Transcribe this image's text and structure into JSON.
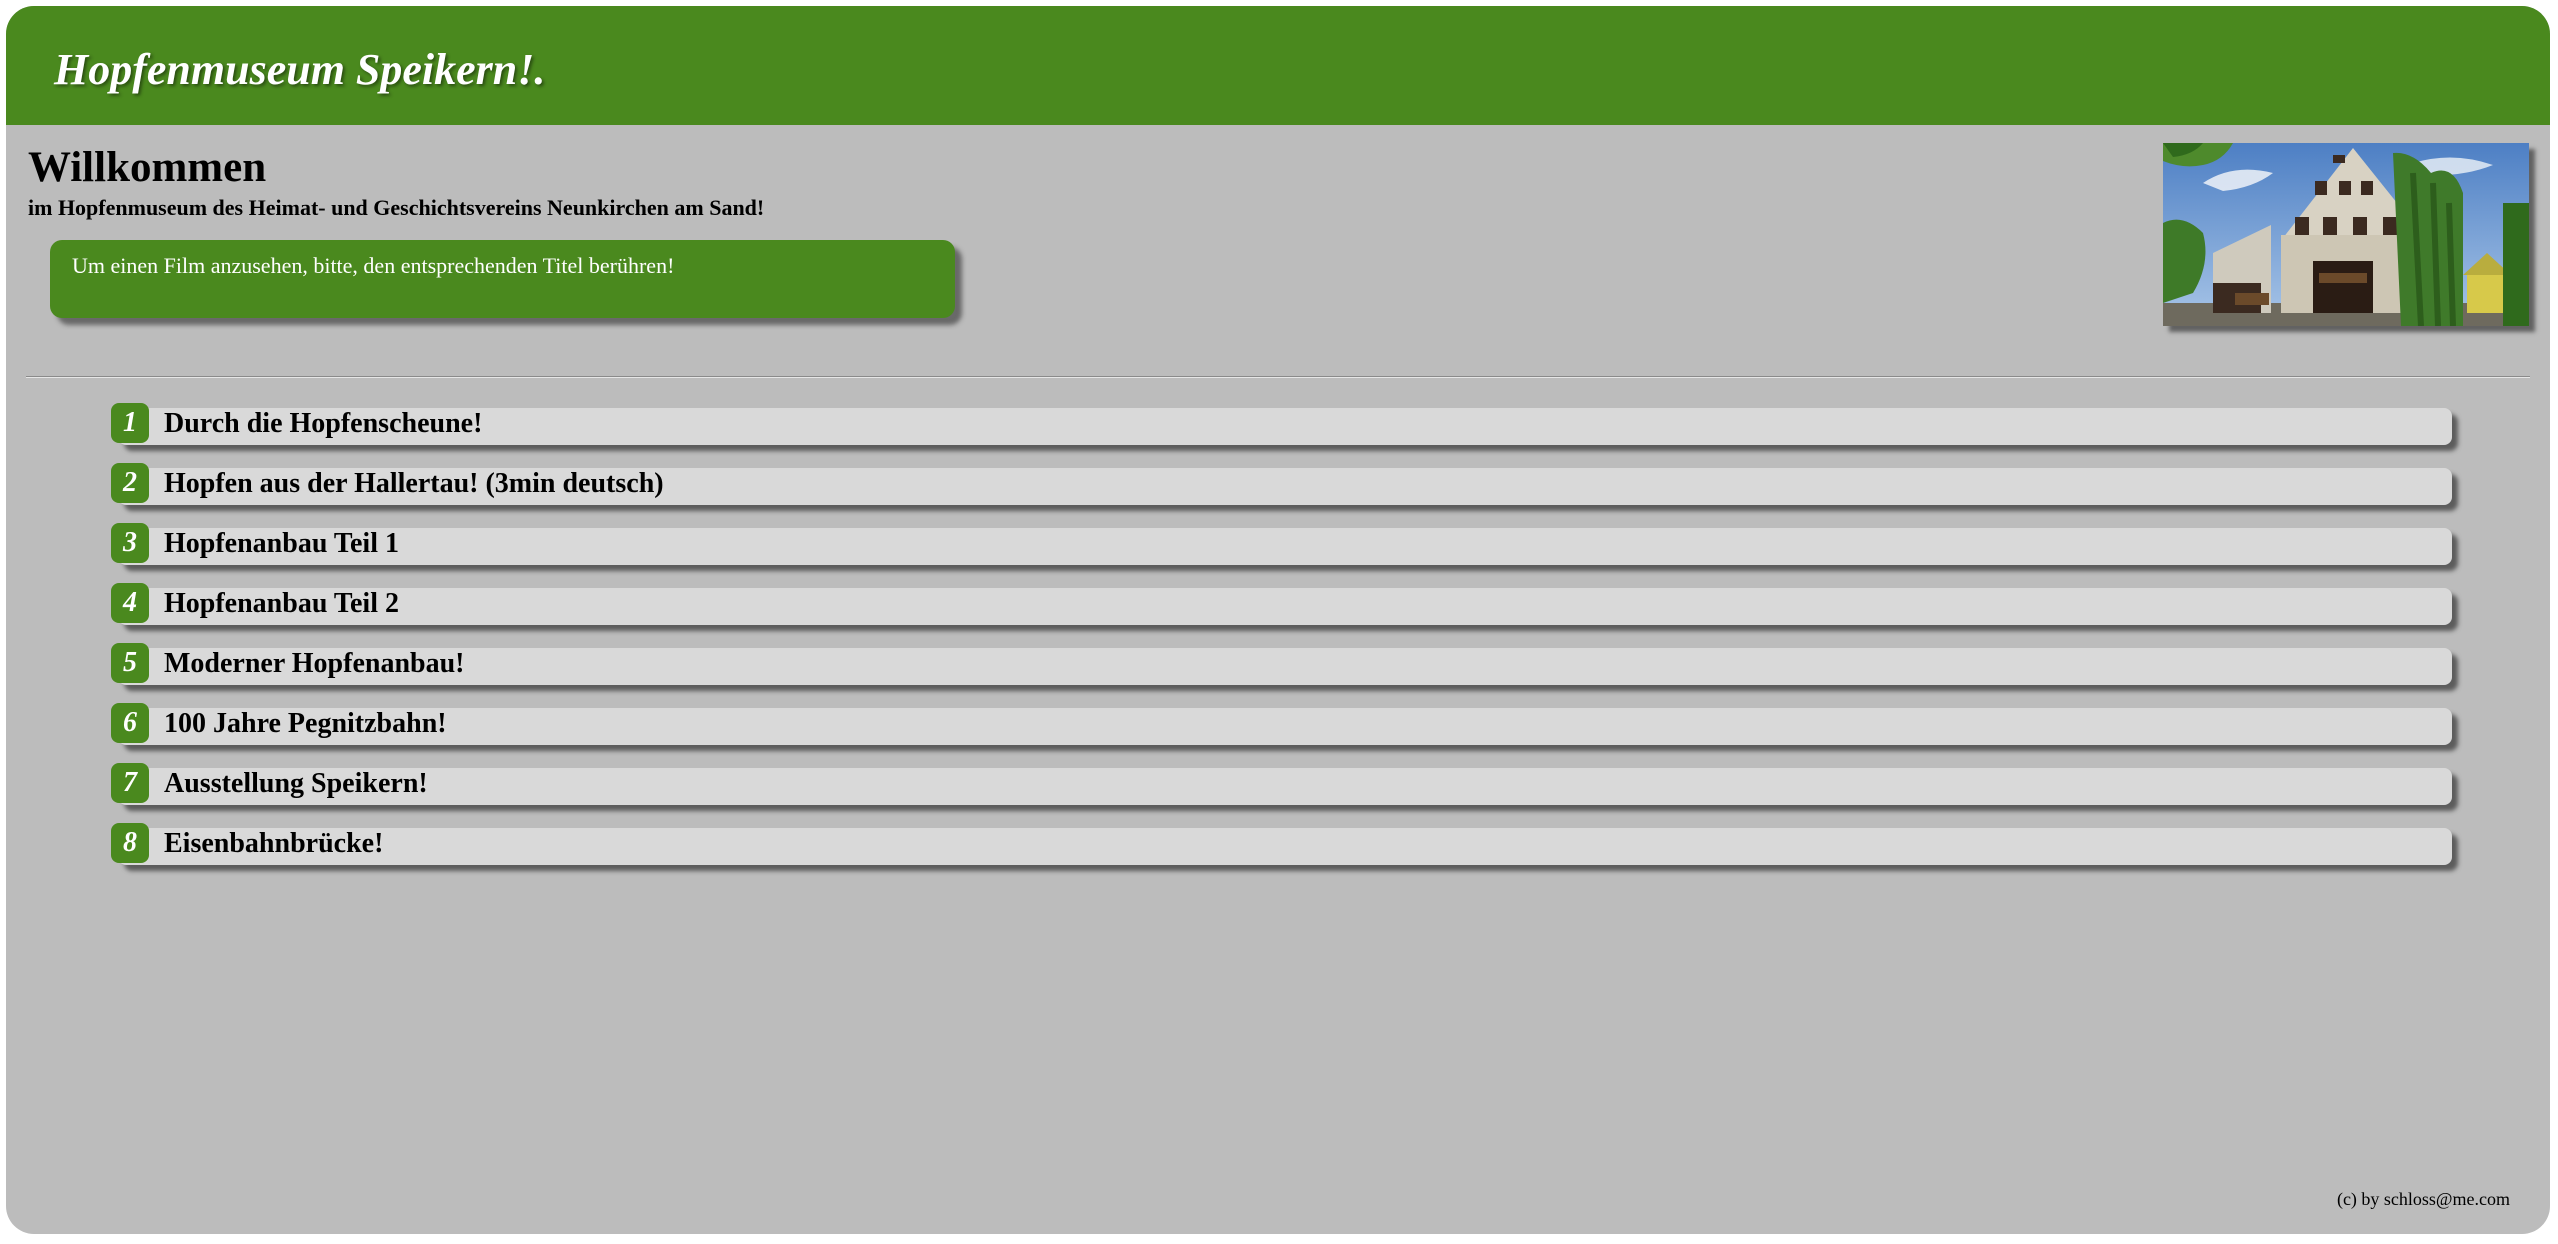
{
  "header": {
    "site_title": "Hopfenmuseum Speikern!."
  },
  "welcome": {
    "heading": "Willkommen",
    "subtitle": "im Hopfenmuseum des Heimat- und Geschichtsvereins Neunkirchen am Sand!"
  },
  "info_box": {
    "text": "Um einen Film anzusehen, bitte, den entsprechenden Titel berühren!"
  },
  "photo": {
    "icon": "museum-photo"
  },
  "videos": [
    {
      "number": "1",
      "title": "Durch die Hopfenscheune!"
    },
    {
      "number": "2",
      "title": "Hopfen aus der Hallertau! (3min deutsch)"
    },
    {
      "number": "3",
      "title": "Hopfenanbau Teil 1"
    },
    {
      "number": "4",
      "title": "Hopfenanbau Teil 2"
    },
    {
      "number": "5",
      "title": "Moderner Hopfenanbau!"
    },
    {
      "number": "6",
      "title": "100 Jahre Pegnitzbahn!"
    },
    {
      "number": "7",
      "title": "Ausstellung Speikern!"
    },
    {
      "number": "8",
      "title": "Eisenbahnbrücke!"
    }
  ],
  "footer": {
    "credit": "(c) by schloss@me.com"
  },
  "colors": {
    "accent_green": "#4a891e",
    "background": "#bcbcbc",
    "list_bar": "#d9d9d9"
  }
}
